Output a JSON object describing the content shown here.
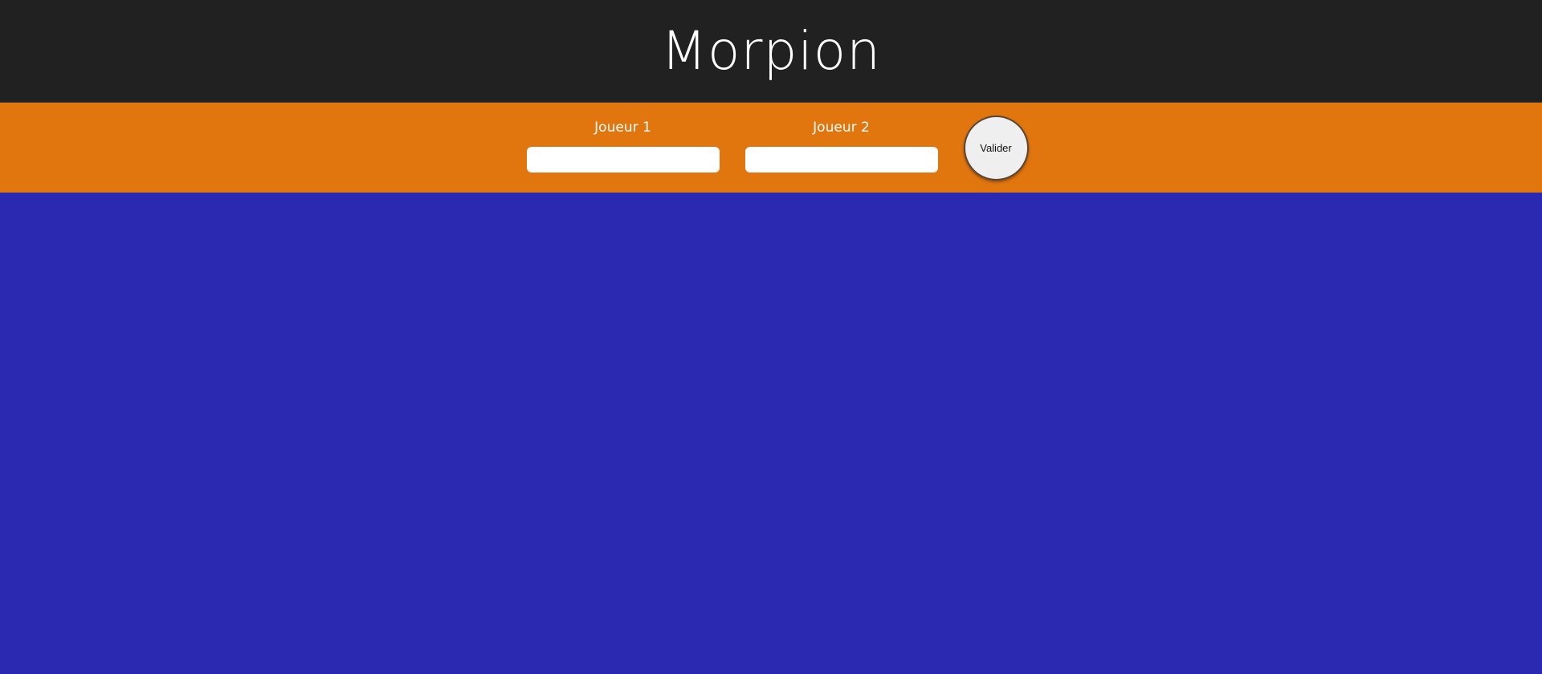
{
  "header": {
    "title": "Morpion"
  },
  "players": {
    "player1": {
      "label": "Joueur 1",
      "value": "",
      "placeholder": ""
    },
    "player2": {
      "label": "Joueur 2",
      "value": "",
      "placeholder": ""
    },
    "validate_label": "Valider"
  },
  "colors": {
    "header_bg": "#212121",
    "bar_bg": "#e1750e",
    "board_bg": "#2b28b2"
  }
}
